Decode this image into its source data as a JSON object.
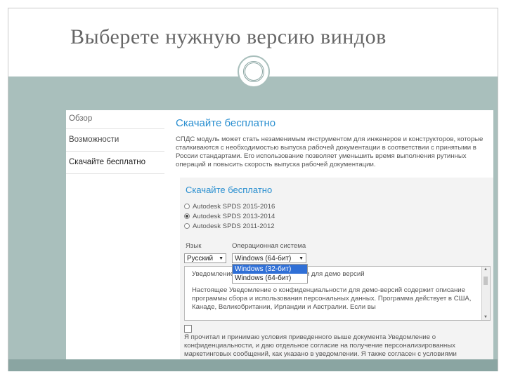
{
  "slide": {
    "title": "Выберете нужную версию виндов"
  },
  "site": {
    "sidebar": [
      "Обзор",
      "Возможности",
      "Скачайте бесплатно"
    ],
    "heading": "Скачайте бесплатно",
    "intro": "СПДС модуль может стать незаменимым инструментом для инженеров и конструкторов, которые сталкиваются с необходимостью выпуска рабочей документации в соответствии с принятыми в России стандартами. Его использование позволяет уменьшить время выполнения рутинных операций и повысить скорость выпуска рабочей документации.",
    "panel_heading": "Скачайте бесплатно",
    "versions": [
      {
        "label": "Autodesk SPDS 2015-2016",
        "selected": false
      },
      {
        "label": "Autodesk SPDS 2013-2014",
        "selected": true
      },
      {
        "label": "Autodesk SPDS 2011-2012",
        "selected": false
      }
    ],
    "language_label": "Язык",
    "language_value": "Русский",
    "os_label": "Операционная система",
    "os_value": "Windows (64-бит)",
    "os_options": [
      {
        "label": "Windows (32-бит)",
        "highlighted": true
      },
      {
        "label": "Windows (64-бит)",
        "highlighted": false
      }
    ],
    "notice_title": "Уведомление о конфиденциальности для демо версий",
    "notice_body": "Настоящее Уведомление о конфиденциальности для демо-версий содержит описание программы сбора и использования персональных данных. Программа действует в США, Канаде, Великобритании, Ирландии и Австралии. Если вы",
    "accept_text": "Я прочитал и принимаю условия приведенного выше документа Уведомление о конфиденциальности, и даю отдельное согласие на получение персонализированных маркетинговых сообщений, как указано в уведомлении. Я также согласен с условиями"
  }
}
